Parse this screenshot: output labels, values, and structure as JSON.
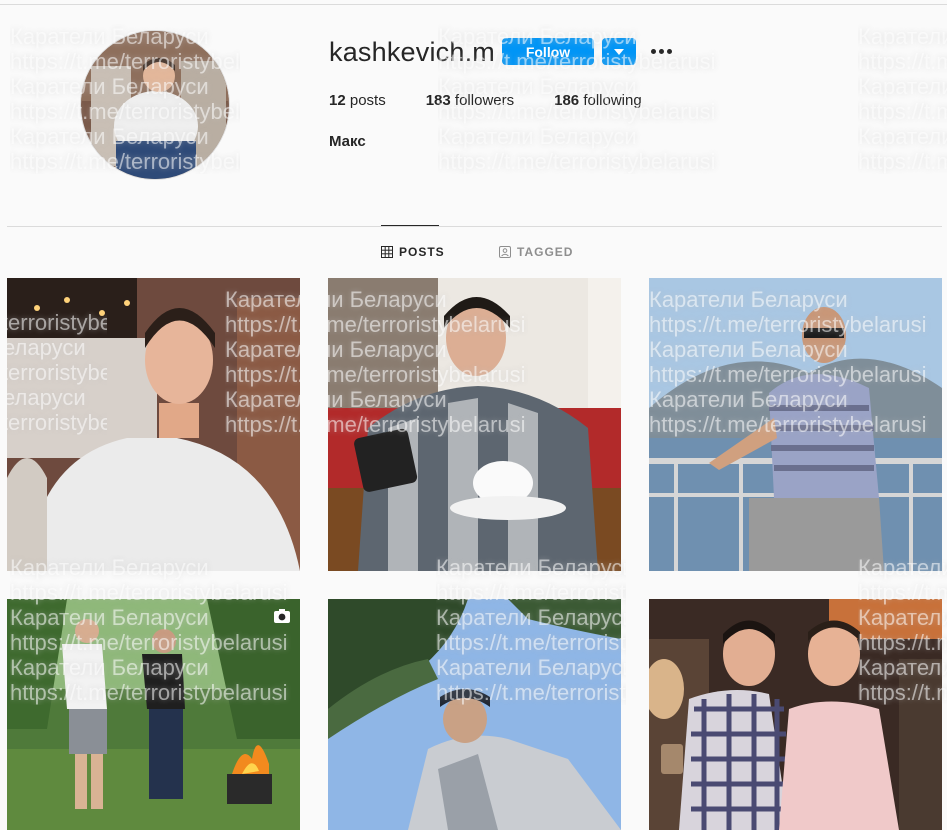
{
  "profile": {
    "username": "kashkevich.m",
    "follow_label": "Follow",
    "posts_count": "12",
    "posts_label": "posts",
    "followers_count": "183",
    "followers_label": "followers",
    "following_count": "186",
    "following_label": "following",
    "full_name": "Макс"
  },
  "tabs": [
    {
      "label": "POSTS",
      "active": true,
      "icon": "grid-icon"
    },
    {
      "label": "TAGGED",
      "active": false,
      "icon": "tagged-icon"
    }
  ],
  "posts": [
    {
      "subject": "man in white sweater sitting",
      "type": "photo"
    },
    {
      "subject": "man in plaid shirt with phone and coffee cup",
      "type": "photo"
    },
    {
      "subject": "man in striped polo on lakeside balcony",
      "type": "photo"
    },
    {
      "subject": "two men in forest by barbecue",
      "type": "video"
    },
    {
      "subject": "man photographed from below against trees",
      "type": "photo"
    },
    {
      "subject": "two men at a party",
      "type": "photo"
    }
  ],
  "watermark": {
    "line1": "Каратели Беларуси",
    "line2": "https://t.me/terroristybelarusi"
  },
  "colors": {
    "accent": "#0095f6",
    "text": "#262626",
    "secondary": "#8e8e8e",
    "border": "#dbdbdb",
    "background": "#fafafa"
  }
}
